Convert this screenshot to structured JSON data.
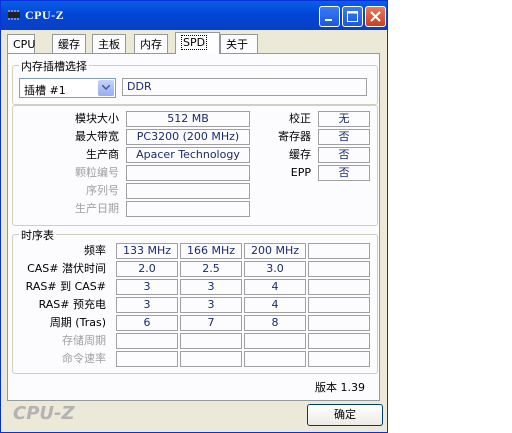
{
  "window": {
    "title": "CPU-Z"
  },
  "tabs": [
    "CPU",
    "缓存",
    "主板",
    "内存",
    "SPD",
    "关于"
  ],
  "active_tab": "SPD",
  "slot_group": {
    "title": "内存插槽选择",
    "slot_value": "插槽 #1",
    "memory_type": "DDR"
  },
  "module": {
    "rows": [
      {
        "label": "模块大小",
        "value": "512 MB",
        "dim": false
      },
      {
        "label": "最大带宽",
        "value": "PC3200 (200 MHz)",
        "dim": false
      },
      {
        "label": "生产商",
        "value": "Apacer Technology",
        "dim": false
      },
      {
        "label": "颗粒编号",
        "value": "",
        "dim": true
      },
      {
        "label": "序列号",
        "value": "",
        "dim": true
      },
      {
        "label": "生产日期",
        "value": "",
        "dim": true
      }
    ],
    "flags": [
      {
        "label": "校正",
        "value": "无"
      },
      {
        "label": "寄存器",
        "value": "否"
      },
      {
        "label": "缓存",
        "value": "否"
      },
      {
        "label": "EPP",
        "value": "否"
      }
    ]
  },
  "timing": {
    "title": "时序表",
    "rows": [
      {
        "label": "频率",
        "values": [
          "133 MHz",
          "166 MHz",
          "200 MHz",
          ""
        ],
        "dim": false
      },
      {
        "label": "CAS# 潜伏时间",
        "values": [
          "2.0",
          "2.5",
          "3.0",
          ""
        ],
        "dim": false
      },
      {
        "label": "RAS# 到 CAS#",
        "values": [
          "3",
          "3",
          "4",
          ""
        ],
        "dim": false
      },
      {
        "label": "RAS# 预充电",
        "values": [
          "3",
          "3",
          "4",
          ""
        ],
        "dim": false
      },
      {
        "label": "周期 (Tras)",
        "values": [
          "6",
          "7",
          "8",
          ""
        ],
        "dim": false
      },
      {
        "label": "存储周期",
        "values": [
          "",
          "",
          "",
          ""
        ],
        "dim": true
      },
      {
        "label": "命令速率",
        "values": [
          "",
          "",
          "",
          ""
        ],
        "dim": true
      }
    ]
  },
  "footer": {
    "version": "版本 1.39",
    "logo": "CPU-Z",
    "ok_label": "确定"
  }
}
